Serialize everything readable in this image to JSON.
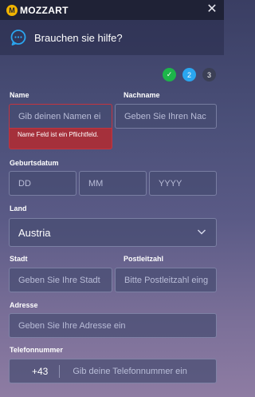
{
  "brand": {
    "logo_letter": "M",
    "name": "MOZZART"
  },
  "close_label": "✕",
  "help": {
    "title": "Brauchen sie hilfe?"
  },
  "steps": [
    {
      "label": "✓",
      "state": "done"
    },
    {
      "label": "2",
      "state": "active"
    },
    {
      "label": "3",
      "state": "pending"
    }
  ],
  "form": {
    "name": {
      "label": "Name",
      "placeholder": "Gib deinen Namen ei",
      "error": "Name Feld ist ein Pflichtfeld."
    },
    "lastname": {
      "label": "Nachname",
      "placeholder": "Geben Sie Ihren Nac"
    },
    "birthdate": {
      "label": "Geburtsdatum",
      "day": "DD",
      "month": "MM",
      "year": "YYYY"
    },
    "country": {
      "label": "Land",
      "value": "Austria"
    },
    "city": {
      "label": "Stadt",
      "placeholder": "Geben Sie Ihre Stadt"
    },
    "zip": {
      "label": "Postleitzahl",
      "placeholder": "Bitte Postleitzahl eing"
    },
    "address": {
      "label": "Adresse",
      "placeholder": "Geben Sie Ihre Adresse ein"
    },
    "phone": {
      "label": "Telefonnummer",
      "prefix": "+43",
      "placeholder": "Gib deine Telefonnummer ein"
    }
  }
}
